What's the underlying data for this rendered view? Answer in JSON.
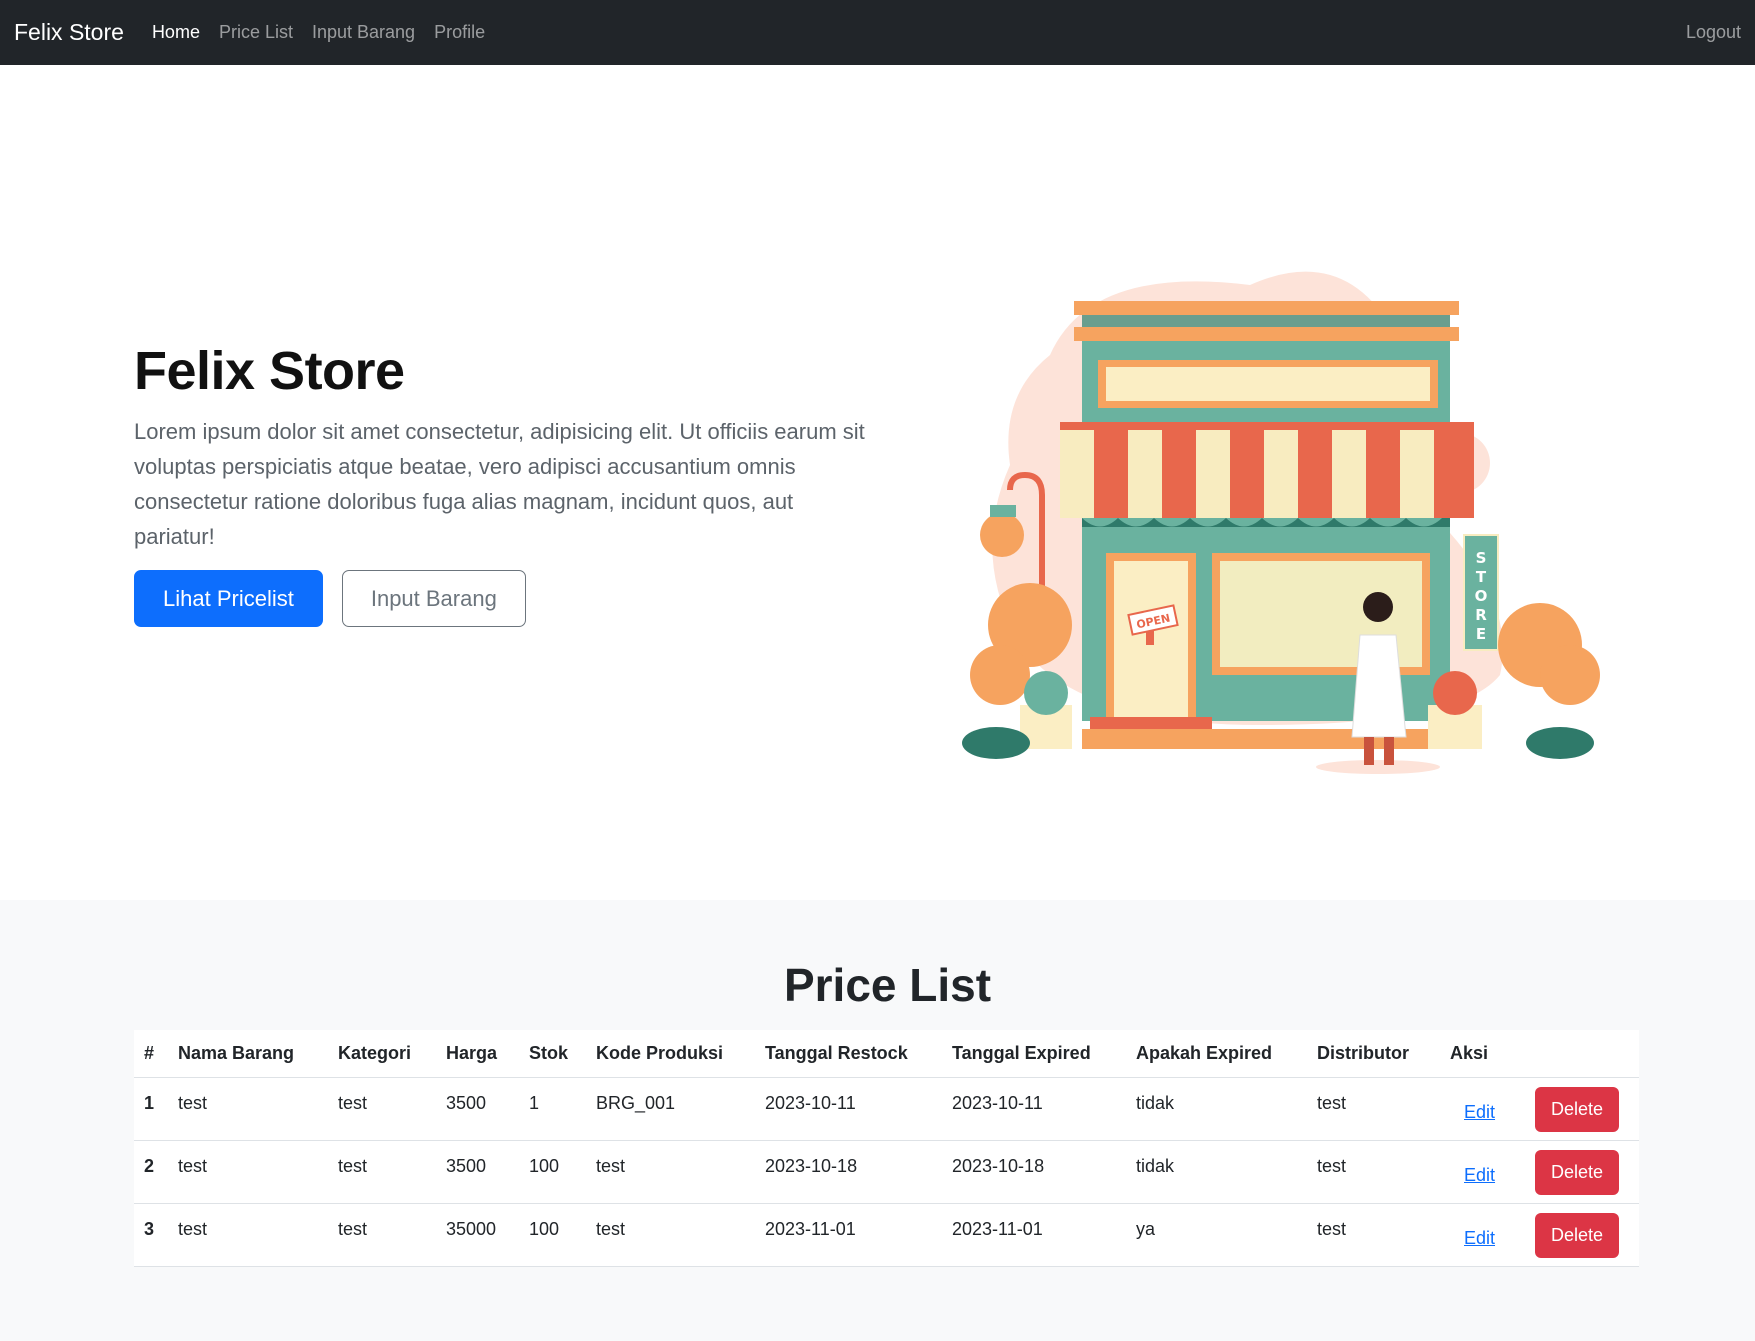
{
  "navbar": {
    "brand": "Felix Store",
    "links": [
      "Home",
      "Price List",
      "Input Barang",
      "Profile"
    ],
    "logout": "Logout"
  },
  "hero": {
    "title": "Felix Store",
    "lead": "Lorem ipsum dolor sit amet consectetur, adipisicing elit. Ut officiis earum sit voluptas perspiciatis atque beatae, vero adipisci accusantium omnis consectetur ratione doloribus fuga alias magnam, incidunt quos, aut pariatur!",
    "primary_button": "Lihat Pricelist",
    "secondary_button": "Input Barang",
    "illustration": {
      "open_sign": "OPEN",
      "store_sign": [
        "S",
        "T",
        "O",
        "R",
        "E"
      ]
    }
  },
  "price_list": {
    "title": "Price List",
    "headers": [
      "#",
      "Nama Barang",
      "Kategori",
      "Harga",
      "Stok",
      "Kode Produksi",
      "Tanggal Restock",
      "Tanggal Expired",
      "Apakah Expired",
      "Distributor",
      "Aksi"
    ],
    "edit_label": "Edit",
    "delete_label": "Delete",
    "rows": [
      [
        "1",
        "test",
        "test",
        "3500",
        "1",
        "BRG_001",
        "2023-10-11",
        "2023-10-11",
        "tidak",
        "test"
      ],
      [
        "2",
        "test",
        "test",
        "3500",
        "100",
        "test",
        "2023-10-18",
        "2023-10-18",
        "tidak",
        "test"
      ],
      [
        "3",
        "test",
        "test",
        "35000",
        "100",
        "test",
        "2023-11-01",
        "2023-11-01",
        "ya",
        "test"
      ]
    ]
  },
  "colors": {
    "navbar_bg": "#212529",
    "primary": "#0d6efd",
    "danger": "#dc3545",
    "section_bg": "#f8f9fa"
  }
}
